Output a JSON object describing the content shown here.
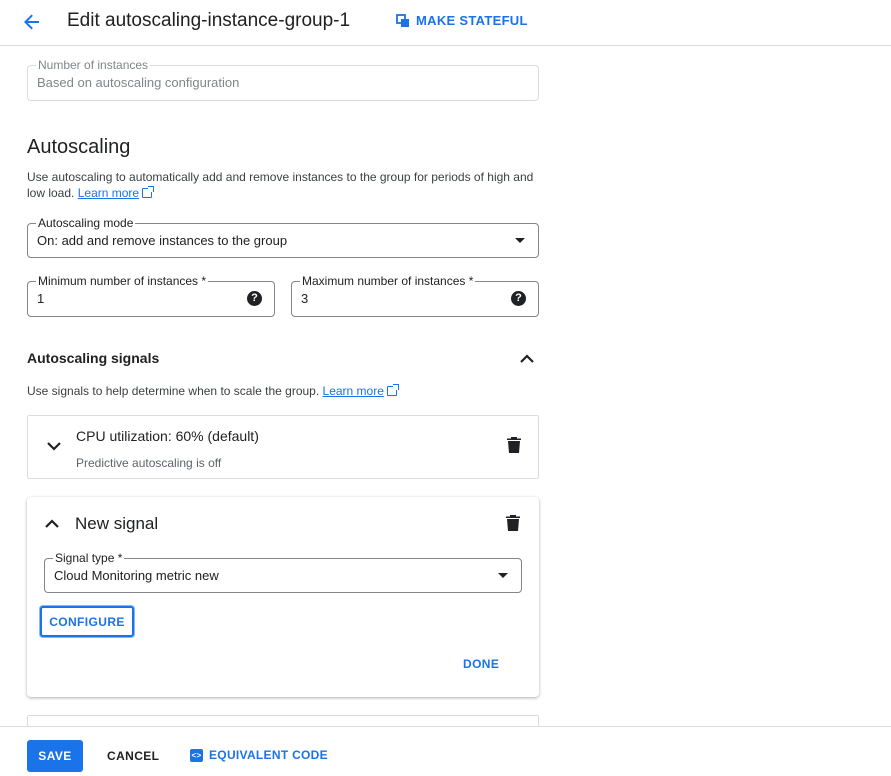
{
  "header": {
    "title": "Edit autoscaling-instance-group-1",
    "make_stateful_label": "MAKE STATEFUL"
  },
  "number_of_instances": {
    "label": "Number of instances",
    "value": "Based on autoscaling configuration"
  },
  "autoscaling": {
    "heading": "Autoscaling",
    "description": "Use autoscaling to automatically add and remove instances to the group for periods of high and low load.",
    "learn_more": "Learn more",
    "mode": {
      "label": "Autoscaling mode",
      "value": "On: add and remove instances to the group"
    },
    "min_instances": {
      "label": "Minimum number of instances *",
      "value": "1"
    },
    "max_instances": {
      "label": "Maximum number of instances *",
      "value": "3"
    }
  },
  "signals": {
    "heading": "Autoscaling signals",
    "description": "Use signals to help determine when to scale the group.",
    "learn_more": "Learn more",
    "cpu_card": {
      "title": "CPU utilization: 60% (default)",
      "subtitle": "Predictive autoscaling is off"
    },
    "new_signal_card": {
      "title": "New signal",
      "signal_type": {
        "label": "Signal type *",
        "value": "Cloud Monitoring metric new"
      },
      "configure_label": "CONFIGURE",
      "done_label": "DONE"
    }
  },
  "footer": {
    "save_label": "SAVE",
    "cancel_label": "CANCEL",
    "equivalent_code_label": "EQUIVALENT CODE"
  },
  "colors": {
    "accent": "#1a73e8",
    "text": "#202124",
    "border": "#dadce0"
  }
}
